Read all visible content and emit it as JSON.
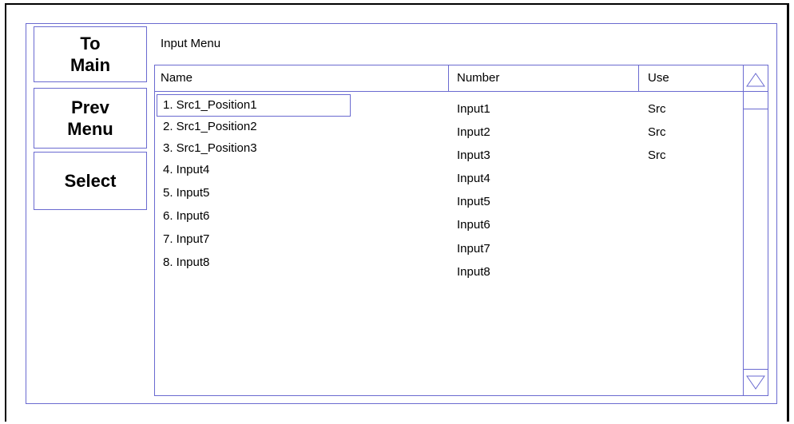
{
  "sidebar": {
    "to_main": "To\nMain",
    "prev_menu": "Prev\nMenu",
    "select": "Select"
  },
  "menu": {
    "title": "Input Menu",
    "columns": {
      "name": "Name",
      "number": "Number",
      "use": "Use"
    },
    "rows": [
      {
        "name": "1. Src1_Position1",
        "number": "Input1",
        "use": "Src"
      },
      {
        "name": "2. Src1_Position2",
        "number": "Input2",
        "use": "Src"
      },
      {
        "name": "3. Src1_Position3",
        "number": "Input3",
        "use": "Src"
      },
      {
        "name": "4. Input4",
        "number": "Input4",
        "use": ""
      },
      {
        "name": "5. Input5",
        "number": "Input5",
        "use": ""
      },
      {
        "name": "6. Input6",
        "number": "Input6",
        "use": ""
      },
      {
        "name": "7. Input7",
        "number": "Input7",
        "use": ""
      },
      {
        "name": "8. Input8",
        "number": "Input8",
        "use": ""
      }
    ],
    "selected_row": 1
  },
  "icons": {
    "scroll_up": "scroll-up-arrow-icon",
    "scroll_down": "scroll-down-arrow-icon"
  },
  "colors": {
    "border": "#6a6ad0"
  }
}
